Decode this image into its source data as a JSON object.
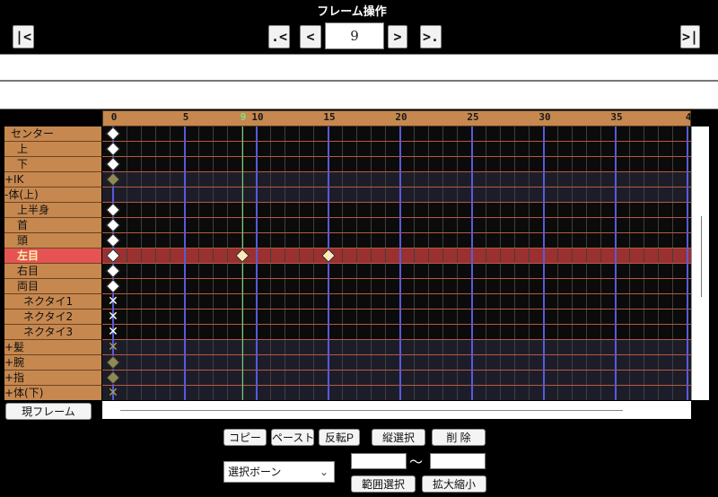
{
  "window": {
    "title": "フレーム操作"
  },
  "nav": {
    "first": "|<",
    "prev_key": ".<",
    "prev": "<",
    "frame": "9",
    "next": ">",
    "next_key": ">.",
    "last": ">|"
  },
  "ruler": {
    "labels": [
      "0",
      "5",
      "9",
      "10",
      "15",
      "20",
      "25",
      "30",
      "35",
      "4"
    ],
    "current_frame": 9
  },
  "bones": [
    {
      "label": "センター",
      "indent": 1
    },
    {
      "label": "上",
      "indent": 2
    },
    {
      "label": "下",
      "indent": 2
    },
    {
      "label": "+IK",
      "indent": 0
    },
    {
      "label": "-体(上)",
      "indent": 0
    },
    {
      "label": "上半身",
      "indent": 2
    },
    {
      "label": "首",
      "indent": 2
    },
    {
      "label": "頭",
      "indent": 2
    },
    {
      "label": "左目",
      "indent": 2,
      "selected": true
    },
    {
      "label": "右目",
      "indent": 2
    },
    {
      "label": "両目",
      "indent": 2
    },
    {
      "label": "ネクタイ1",
      "indent": 3
    },
    {
      "label": "ネクタイ2",
      "indent": 3
    },
    {
      "label": "ネクタイ3",
      "indent": 3
    },
    {
      "label": "+髪",
      "indent": 0
    },
    {
      "label": "+腕",
      "indent": 0
    },
    {
      "label": "+指",
      "indent": 0
    },
    {
      "label": "+体(下)",
      "indent": 0
    }
  ],
  "keyframes": [
    {
      "row": 0,
      "frame": 0,
      "style": "white"
    },
    {
      "row": 1,
      "frame": 0,
      "style": "white"
    },
    {
      "row": 2,
      "frame": 0,
      "style": "white"
    },
    {
      "row": 3,
      "frame": 0,
      "style": "olive"
    },
    {
      "row": 5,
      "frame": 0,
      "style": "white"
    },
    {
      "row": 6,
      "frame": 0,
      "style": "white"
    },
    {
      "row": 7,
      "frame": 0,
      "style": "white"
    },
    {
      "row": 8,
      "frame": 0,
      "style": "white"
    },
    {
      "row": 8,
      "frame": 9,
      "style": "sel"
    },
    {
      "row": 8,
      "frame": 15,
      "style": "sel"
    },
    {
      "row": 9,
      "frame": 0,
      "style": "white"
    },
    {
      "row": 10,
      "frame": 0,
      "style": "white"
    },
    {
      "row": 11,
      "frame": 0,
      "style": "x-white"
    },
    {
      "row": 12,
      "frame": 0,
      "style": "x-white"
    },
    {
      "row": 13,
      "frame": 0,
      "style": "x-white"
    },
    {
      "row": 14,
      "frame": 0,
      "style": "x-olive"
    },
    {
      "row": 15,
      "frame": 0,
      "style": "olive"
    },
    {
      "row": 16,
      "frame": 0,
      "style": "olive"
    },
    {
      "row": 17,
      "frame": 0,
      "style": "x-olive"
    }
  ],
  "buttons": {
    "current_frame": "現フレーム",
    "copy": "コピー",
    "paste": "ペースト",
    "reverse_paste": "反転P",
    "vertical_select": "縦選択",
    "delete": "削 除",
    "range_select": "範囲選択",
    "scale": "拡大縮小"
  },
  "select": {
    "bone_select": "選択ボーン"
  },
  "range": {
    "separator": "～"
  },
  "colors": {
    "ruler_bg": "#c6884f",
    "selected_row": "#e65353",
    "current_frame_line": "#6fd36f",
    "major_line": "#5a5ad8"
  }
}
